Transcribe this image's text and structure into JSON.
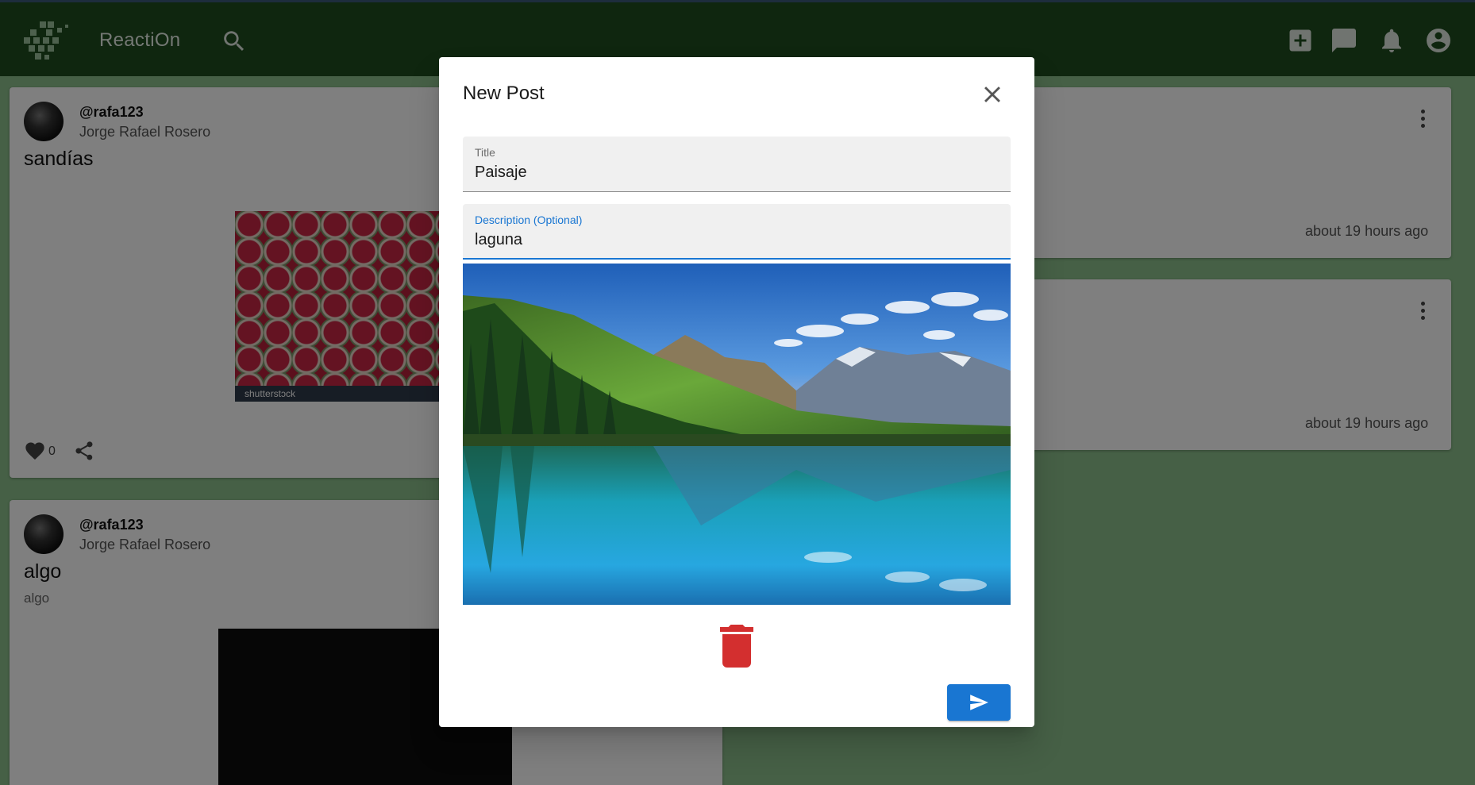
{
  "app": {
    "brand": "ReactiOn",
    "icons": [
      "logo-icon",
      "search-icon",
      "add-post-icon",
      "chat-icon",
      "notifications-icon",
      "account-icon"
    ]
  },
  "feed": {
    "posts": [
      {
        "handle": "@rafa123",
        "name": "Jorge Rafael Rosero",
        "title": "sandías",
        "likes": "0",
        "image_caption": "shutterstɔck",
        "time": "about 19 hours ago"
      },
      {
        "handle": "@rafa123",
        "name": "Jorge Rafael Rosero",
        "title": "algo",
        "description": "algo",
        "time": "about 19 hours ago"
      }
    ]
  },
  "dialog": {
    "title": "New Post",
    "title_field": {
      "label": "Title",
      "value": "Paisaje"
    },
    "description_field": {
      "label": "Description (Optional)",
      "value": "laguna"
    },
    "colors": {
      "primary": "#1976d2",
      "delete": "#d32f2f",
      "appbar": "#1f4d1f"
    }
  }
}
